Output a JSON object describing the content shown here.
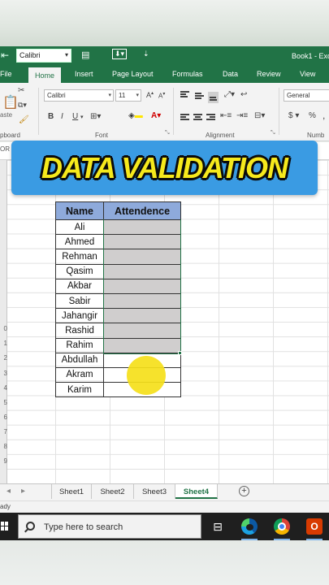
{
  "window": {
    "font_name": "Calibri",
    "title": "Book1 - Exc"
  },
  "ribbon_tabs": [
    "File",
    "Home",
    "Insert",
    "Page Layout",
    "Formulas",
    "Data",
    "Review",
    "View"
  ],
  "ribbon": {
    "font_name": "Calibri",
    "font_size": "11",
    "number_format": "General",
    "group_clipboard": "pboard",
    "group_font": "Font",
    "group_alignment": "Alignment",
    "group_number": "Numb",
    "paste_label": "aste",
    "currency": "$",
    "percent": "%",
    "comma": ","
  },
  "name_box": "OR",
  "banner": {
    "text": "DATA VALIDATION",
    "bg_color": "#3a9be3",
    "text_color": "#f6e91c"
  },
  "table": {
    "headers": [
      "Name",
      "Attendence"
    ],
    "header_color": "#8eaadb",
    "shade_color": "#d0cece",
    "rows": [
      {
        "name": "Ali",
        "shaded": true
      },
      {
        "name": "Ahmed",
        "shaded": true
      },
      {
        "name": "Rehman",
        "shaded": true
      },
      {
        "name": "Qasim",
        "shaded": true
      },
      {
        "name": "Akbar",
        "shaded": true
      },
      {
        "name": "Sabir",
        "shaded": true
      },
      {
        "name": "Jahangir",
        "shaded": true
      },
      {
        "name": "Rashid",
        "shaded": true
      },
      {
        "name": "Rahim",
        "shaded": true
      },
      {
        "name": "Abdullah",
        "shaded": false
      },
      {
        "name": "Akram",
        "shaded": false
      },
      {
        "name": "Karim",
        "shaded": false
      }
    ]
  },
  "row_numbers": [
    "0",
    "1",
    "2",
    "3",
    "4",
    "5",
    "6",
    "7",
    "8",
    "9"
  ],
  "sheets": {
    "tabs": [
      "Sheet1",
      "Sheet2",
      "Sheet3",
      "Sheet4"
    ],
    "active": "Sheet4"
  },
  "status": "ady",
  "taskbar": {
    "search_placeholder": "Type here to search"
  },
  "colors": {
    "excel_green": "#217346",
    "taskbar": "#1f1f1f"
  }
}
